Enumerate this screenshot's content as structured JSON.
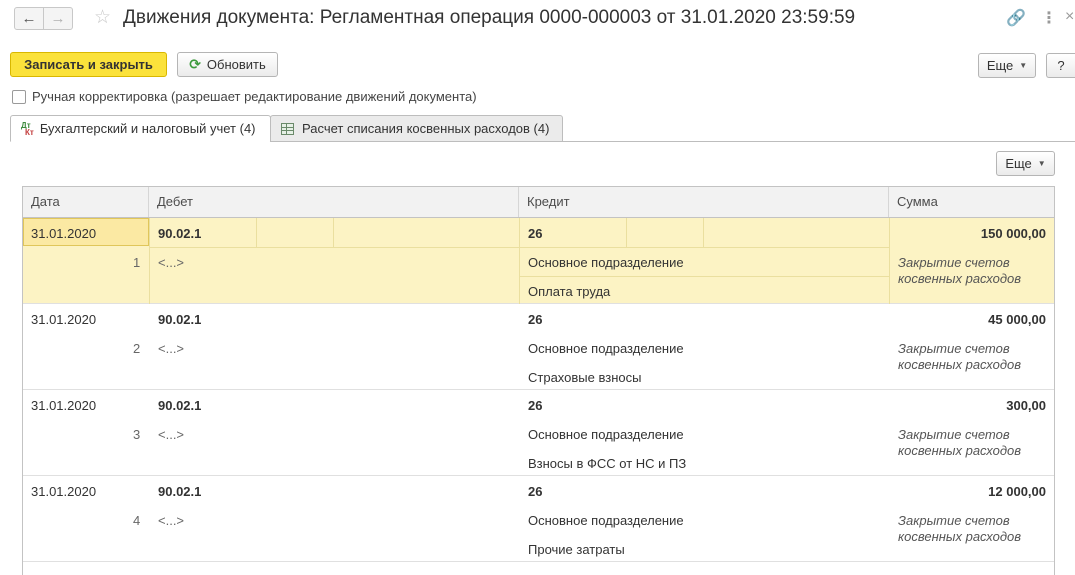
{
  "window": {
    "title": "Движения документа: Регламентная операция 0000-000003 от 31.01.2020 23:59:59",
    "back_icon": "arrow-left-icon",
    "forward_icon": "arrow-right-icon",
    "favorite_icon": "star-icon",
    "link_icon": "link-icon",
    "menu_icon": "more-vertical-icon",
    "close_icon": "close-icon"
  },
  "toolbar": {
    "save_close_label": "Записать и закрыть",
    "refresh_label": "Обновить",
    "more_label": "Еще",
    "help_label": "?"
  },
  "manual_correction": {
    "label": "Ручная корректировка (разрешает редактирование движений документа)",
    "checked": false
  },
  "tabs": [
    {
      "label": "Бухгалтерский и налоговый учет (4)",
      "icon": "dt-kt-icon",
      "active": true
    },
    {
      "label": "Расчет списания косвенных расходов (4)",
      "icon": "table-icon",
      "active": false
    }
  ],
  "table_toolbar": {
    "more_label": "Еще"
  },
  "table": {
    "columns": [
      "Дата",
      "Дебет",
      "Кредит",
      "Сумма"
    ],
    "rows": [
      {
        "date": "31.01.2020",
        "num": "1",
        "debit_account": "90.02.1",
        "debit_sub": "<...>",
        "credit_account": "26",
        "credit_sub1": "Основное подразделение",
        "credit_sub2": "Оплата труда",
        "amount": "150 000,00",
        "content": "Закрытие счетов косвенных расходов"
      },
      {
        "date": "31.01.2020",
        "num": "2",
        "debit_account": "90.02.1",
        "debit_sub": "<...>",
        "credit_account": "26",
        "credit_sub1": "Основное подразделение",
        "credit_sub2": "Страховые взносы",
        "amount": "45 000,00",
        "content": "Закрытие счетов косвенных расходов"
      },
      {
        "date": "31.01.2020",
        "num": "3",
        "debit_account": "90.02.1",
        "debit_sub": "<...>",
        "credit_account": "26",
        "credit_sub1": "Основное подразделение",
        "credit_sub2": "Взносы в ФСС от НС и ПЗ",
        "amount": "300,00",
        "content": "Закрытие счетов косвенных расходов"
      },
      {
        "date": "31.01.2020",
        "num": "4",
        "debit_account": "90.02.1",
        "debit_sub": "<...>",
        "credit_account": "26",
        "credit_sub1": "Основное подразделение",
        "credit_sub2": "Прочие затраты",
        "amount": "12 000,00",
        "content": "Закрытие счетов косвенных расходов"
      }
    ]
  },
  "colors": {
    "primary_button": "#fbe23b",
    "selected_row": "#fcf3c4",
    "header_bg": "#f2f2f2"
  }
}
